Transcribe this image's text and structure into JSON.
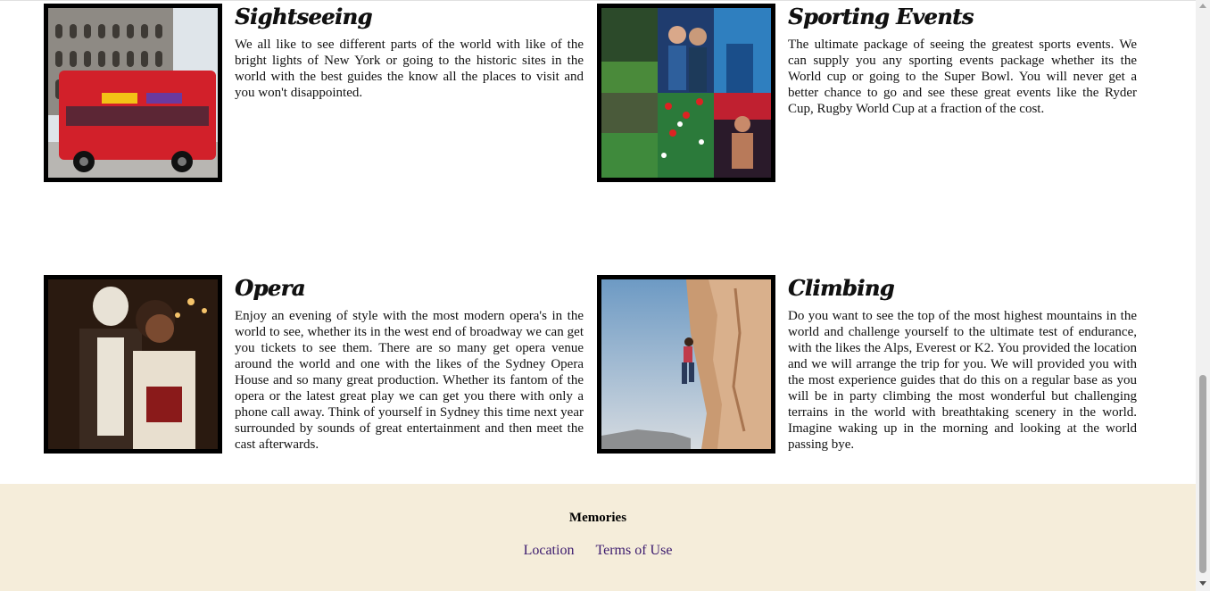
{
  "cards": [
    {
      "title": "Sightseeing",
      "text": "We all like to see different parts of the world with like of the bright lights of New York or going to the historic sites in the world with the best guides the know all the places to visit and you won't disappointed."
    },
    {
      "title": "Sporting Events",
      "text": "The ultimate package of seeing the greatest sports events. We can supply you any sporting events package whether its the World cup or going to the Super Bowl. You will never get a better chance to go and see these great events like the Ryder Cup, Rugby World Cup at a fraction of the cost."
    },
    {
      "title": "Opera",
      "text": "Enjoy an evening of style with the most modern opera's in the world to see, whether its in the west end of broadway we can get you tickets to see them. There are so many get opera venue around the world and one with the likes of the Sydney Opera House and so many great production. Whether its fantom of the opera or the latest great play we can get you there with only a phone call away. Think of yourself in Sydney this time next year surrounded by sounds of great entertainment and then meet the cast afterwards."
    },
    {
      "title": "Climbing",
      "text": "Do you want to see the top of the most highest mountains in the world and challenge yourself to the ultimate test of endurance, with the likes the Alps, Everest or K2. You provided the location and we will arrange the trip for you. We will provided you with the most experience guides that do this on a regular base as you will be in party climbing the most wonderful but challenging terrains in the world with breathtaking scenery in the world. Imagine waking up in the morning and looking at the world passing bye."
    }
  ],
  "footer": {
    "brand": "Memories",
    "links": [
      "Location",
      "Terms of Use"
    ]
  },
  "colors": {
    "footer_bg": "#f5edda",
    "link": "#3b1a6e",
    "image_border": "#000000"
  }
}
